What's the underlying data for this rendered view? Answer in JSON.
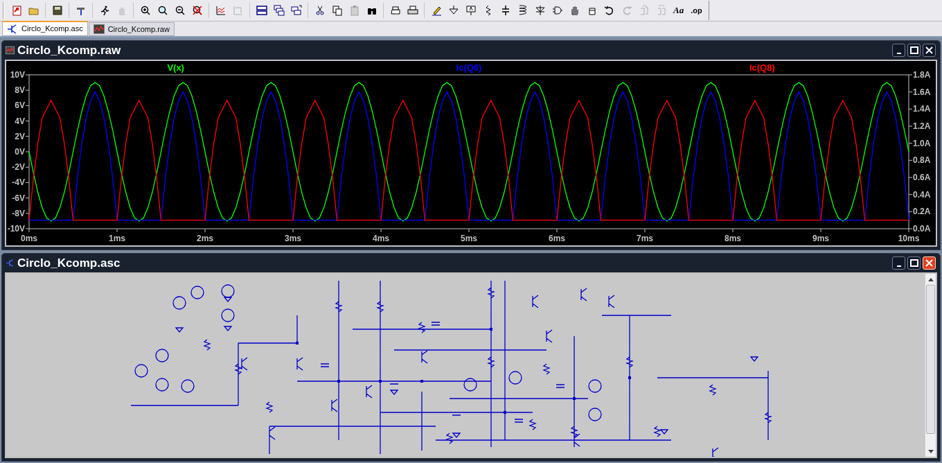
{
  "toolbar": {
    "text_buttons": [
      {
        "kind": "font",
        "label": "Aa"
      },
      {
        "kind": "op",
        "label": ".op"
      }
    ]
  },
  "tabs": [
    {
      "label": "Circlo_Kcomp.asc",
      "kind": "schematic",
      "selected": true
    },
    {
      "label": "Circlo_Kcomp.raw",
      "kind": "waveform",
      "selected": false
    }
  ],
  "windows": [
    {
      "kind": "waveform",
      "title": "Circlo_Kcomp.raw",
      "active": false,
      "chart_data": {
        "type": "line",
        "xlim": [
          0,
          10
        ],
        "ylim": [
          -10,
          10
        ],
        "y2lim": [
          0,
          1.8
        ],
        "xticks": [
          {
            "value": 0,
            "label": "0ms"
          },
          {
            "value": 1,
            "label": "1ms"
          },
          {
            "value": 2,
            "label": "2ms"
          },
          {
            "value": 3,
            "label": "3ms"
          },
          {
            "value": 4,
            "label": "4ms"
          },
          {
            "value": 5,
            "label": "5ms"
          },
          {
            "value": 6,
            "label": "6ms"
          },
          {
            "value": 7,
            "label": "7ms"
          },
          {
            "value": 8,
            "label": "8ms"
          },
          {
            "value": 9,
            "label": "9ms"
          },
          {
            "value": 10,
            "label": "10ms"
          }
        ],
        "yticks": [
          {
            "value": 10,
            "label": "10V"
          },
          {
            "value": 8,
            "label": "8V"
          },
          {
            "value": 6,
            "label": "6V"
          },
          {
            "value": 4,
            "label": "4V"
          },
          {
            "value": 2,
            "label": "2V"
          },
          {
            "value": 0,
            "label": "0V"
          },
          {
            "value": -2,
            "label": "-2V"
          },
          {
            "value": -4,
            "label": "-4V"
          },
          {
            "value": -6,
            "label": "-6V"
          },
          {
            "value": -8,
            "label": "-8V"
          },
          {
            "value": -10,
            "label": "-10V"
          }
        ],
        "y2ticks": [
          {
            "value": 1.8,
            "label": "1.8A"
          },
          {
            "value": 1.6,
            "label": "1.6A"
          },
          {
            "value": 1.4,
            "label": "1.4A"
          },
          {
            "value": 1.2,
            "label": "1.2A"
          },
          {
            "value": 1.0,
            "label": "1.0A"
          },
          {
            "value": 0.8,
            "label": "0.8A"
          },
          {
            "value": 0.6,
            "label": "0.6A"
          },
          {
            "value": 0.4,
            "label": "0.4A"
          },
          {
            "value": 0.2,
            "label": "0.2A"
          },
          {
            "value": 0.0,
            "label": "0.0A"
          }
        ],
        "x": [
          0,
          0.05,
          0.1,
          0.15,
          0.2,
          0.25,
          0.3,
          0.35,
          0.4,
          0.45,
          0.5,
          0.55,
          0.6,
          0.65,
          0.7,
          0.75,
          0.8,
          0.85,
          0.9,
          0.95,
          1,
          1.05,
          1.1,
          1.15,
          1.2,
          1.25,
          1.3,
          1.35,
          1.4,
          1.45,
          1.5,
          1.55,
          1.6,
          1.65,
          1.7,
          1.75,
          1.8,
          1.85,
          1.9,
          1.95,
          2,
          2.05,
          2.1,
          2.15,
          2.2,
          2.25,
          2.3,
          2.35,
          2.4,
          2.45,
          2.5,
          2.55,
          2.6,
          2.65,
          2.7,
          2.75,
          2.8,
          2.85,
          2.9,
          2.95,
          3,
          3.05,
          3.1,
          3.15,
          3.2,
          3.25,
          3.3,
          3.35,
          3.4,
          3.45,
          3.5,
          3.55,
          3.6,
          3.65,
          3.7,
          3.75,
          3.8,
          3.85,
          3.9,
          3.95,
          4,
          4.05,
          4.1,
          4.15,
          4.2,
          4.25,
          4.3,
          4.35,
          4.4,
          4.45,
          4.5,
          4.55,
          4.6,
          4.65,
          4.7,
          4.75,
          4.8,
          4.85,
          4.9,
          4.95,
          5,
          5.05,
          5.1,
          5.15,
          5.2,
          5.25,
          5.3,
          5.35,
          5.4,
          5.45,
          5.5,
          5.55,
          5.6,
          5.65,
          5.7,
          5.75,
          5.8,
          5.85,
          5.9,
          5.95,
          6,
          6.05,
          6.1,
          6.15,
          6.2,
          6.25,
          6.3,
          6.35,
          6.4,
          6.45,
          6.5,
          6.55,
          6.6,
          6.65,
          6.7,
          6.75,
          6.8,
          6.85,
          6.9,
          6.95,
          7,
          7.05,
          7.1,
          7.15,
          7.2,
          7.25,
          7.3,
          7.35,
          7.4,
          7.45,
          7.5,
          7.55,
          7.6,
          7.65,
          7.7,
          7.75,
          7.8,
          7.85,
          7.9,
          7.95,
          8,
          8.05,
          8.1,
          8.15,
          8.2,
          8.25,
          8.3,
          8.35,
          8.4,
          8.45,
          8.5,
          8.55,
          8.6,
          8.65,
          8.7,
          8.75,
          8.8,
          8.85,
          8.9,
          8.95,
          9,
          9.05,
          9.1,
          9.15,
          9.2,
          9.25,
          9.3,
          9.35,
          9.4,
          9.45,
          9.5,
          9.55,
          9.6,
          9.65,
          9.7,
          9.75,
          9.8,
          9.85,
          9.9,
          9.95,
          10
        ],
        "series": [
          {
            "name": "V(x)",
            "color": "#00ff00",
            "values": [
              0,
              -2.8,
              -5.3,
              -7.3,
              -8.6,
              -9,
              -8.6,
              -7.3,
              -5.3,
              -2.8,
              0,
              2.8,
              5.3,
              7.3,
              8.6,
              9,
              8.6,
              7.3,
              5.3,
              2.8,
              0,
              -2.8,
              -5.3,
              -7.3,
              -8.6,
              -9,
              -8.6,
              -7.3,
              -5.3,
              -2.8,
              0,
              2.8,
              5.3,
              7.3,
              8.6,
              9,
              8.6,
              7.3,
              5.3,
              2.8,
              0,
              -2.8,
              -5.3,
              -7.3,
              -8.6,
              -9,
              -8.6,
              -7.3,
              -5.3,
              -2.8,
              0,
              2.8,
              5.3,
              7.3,
              8.6,
              9,
              8.6,
              7.3,
              5.3,
              2.8,
              0,
              -2.8,
              -5.3,
              -7.3,
              -8.6,
              -9,
              -8.6,
              -7.3,
              -5.3,
              -2.8,
              0,
              2.8,
              5.3,
              7.3,
              8.6,
              9,
              8.6,
              7.3,
              5.3,
              2.8,
              0,
              -2.8,
              -5.3,
              -7.3,
              -8.6,
              -9,
              -8.6,
              -7.3,
              -5.3,
              -2.8,
              0,
              2.8,
              5.3,
              7.3,
              8.6,
              9,
              8.6,
              7.3,
              5.3,
              2.8,
              0,
              -2.8,
              -5.3,
              -7.3,
              -8.6,
              -9,
              -8.6,
              -7.3,
              -5.3,
              -2.8,
              0,
              2.8,
              5.3,
              7.3,
              8.6,
              9,
              8.6,
              7.3,
              5.3,
              2.8,
              0,
              -2.8,
              -5.3,
              -7.3,
              -8.6,
              -9,
              -8.6,
              -7.3,
              -5.3,
              -2.8,
              0,
              2.8,
              5.3,
              7.3,
              8.6,
              9,
              8.6,
              7.3,
              5.3,
              2.8,
              0,
              -2.8,
              -5.3,
              -7.3,
              -8.6,
              -9,
              -8.6,
              -7.3,
              -5.3,
              -2.8,
              0,
              2.8,
              5.3,
              7.3,
              8.6,
              9,
              8.6,
              7.3,
              5.3,
              2.8,
              0,
              -2.8,
              -5.3,
              -7.3,
              -8.6,
              -9,
              -8.6,
              -7.3,
              -5.3,
              -2.8,
              0,
              2.8,
              5.3,
              7.3,
              8.6,
              9,
              8.6,
              7.3,
              5.3,
              2.8,
              0,
              -2.8,
              -5.3,
              -7.3,
              -8.6,
              -9,
              -8.6,
              -7.3,
              -5.3,
              -2.8,
              0,
              2.8,
              5.3,
              7.3,
              8.6,
              9,
              8.6,
              7.3,
              5.3,
              2.8,
              0
            ]
          },
          {
            "name": "Ic(Q6)",
            "color": "#0000ff",
            "axis": "y2",
            "values": [
              0.1,
              0.1,
              0.1,
              0.1,
              0.1,
              0.1,
              0.1,
              0.1,
              0.1,
              0.1,
              0.1,
              0.6,
              1.0,
              1.3,
              1.5,
              1.6,
              1.5,
              1.3,
              1.0,
              0.6,
              0.1,
              0.1,
              0.1,
              0.1,
              0.1,
              0.1,
              0.1,
              0.1,
              0.1,
              0.1,
              0.1,
              0.6,
              1.0,
              1.3,
              1.5,
              1.6,
              1.5,
              1.3,
              1.0,
              0.6,
              0.1,
              0.1,
              0.1,
              0.1,
              0.1,
              0.1,
              0.1,
              0.1,
              0.1,
              0.1,
              0.1,
              0.6,
              1.0,
              1.3,
              1.5,
              1.6,
              1.5,
              1.3,
              1.0,
              0.6,
              0.1,
              0.1,
              0.1,
              0.1,
              0.1,
              0.1,
              0.1,
              0.1,
              0.1,
              0.1,
              0.1,
              0.6,
              1.0,
              1.3,
              1.5,
              1.6,
              1.5,
              1.3,
              1.0,
              0.6,
              0.1,
              0.1,
              0.1,
              0.1,
              0.1,
              0.1,
              0.1,
              0.1,
              0.1,
              0.1,
              0.1,
              0.6,
              1.0,
              1.3,
              1.5,
              1.6,
              1.5,
              1.3,
              1.0,
              0.6,
              0.1,
              0.1,
              0.1,
              0.1,
              0.1,
              0.1,
              0.1,
              0.1,
              0.1,
              0.1,
              0.1,
              0.6,
              1.0,
              1.3,
              1.5,
              1.6,
              1.5,
              1.3,
              1.0,
              0.6,
              0.1,
              0.1,
              0.1,
              0.1,
              0.1,
              0.1,
              0.1,
              0.1,
              0.1,
              0.1,
              0.1,
              0.6,
              1.0,
              1.3,
              1.5,
              1.6,
              1.5,
              1.3,
              1.0,
              0.6,
              0.1,
              0.1,
              0.1,
              0.1,
              0.1,
              0.1,
              0.1,
              0.1,
              0.1,
              0.1,
              0.1,
              0.6,
              1.0,
              1.3,
              1.5,
              1.6,
              1.5,
              1.3,
              1.0,
              0.6,
              0.1,
              0.1,
              0.1,
              0.1,
              0.1,
              0.1,
              0.1,
              0.1,
              0.1,
              0.1,
              0.1,
              0.6,
              1.0,
              1.3,
              1.5,
              1.6,
              1.5,
              1.3,
              1.0,
              0.6,
              0.1,
              0.1,
              0.1,
              0.1,
              0.1,
              0.1,
              0.1,
              0.1,
              0.1,
              0.1,
              0.1,
              0.6,
              1.0,
              1.3,
              1.5,
              1.6,
              1.5,
              1.3,
              1.0,
              0.6,
              0.1
            ]
          },
          {
            "name": "Ic(Q8)",
            "color": "#ff0000",
            "axis": "y2",
            "values": [
              0.1,
              0.6,
              1.0,
              1.3,
              1.4,
              1.5,
              1.4,
              1.3,
              1.0,
              0.6,
              0.1,
              0.1,
              0.1,
              0.1,
              0.1,
              0.1,
              0.1,
              0.1,
              0.1,
              0.1,
              0.1,
              0.6,
              1.0,
              1.3,
              1.4,
              1.5,
              1.4,
              1.3,
              1.0,
              0.6,
              0.1,
              0.1,
              0.1,
              0.1,
              0.1,
              0.1,
              0.1,
              0.1,
              0.1,
              0.1,
              0.1,
              0.6,
              1.0,
              1.3,
              1.4,
              1.5,
              1.4,
              1.3,
              1.0,
              0.6,
              0.1,
              0.1,
              0.1,
              0.1,
              0.1,
              0.1,
              0.1,
              0.1,
              0.1,
              0.1,
              0.1,
              0.6,
              1.0,
              1.3,
              1.4,
              1.5,
              1.4,
              1.3,
              1.0,
              0.6,
              0.1,
              0.1,
              0.1,
              0.1,
              0.1,
              0.1,
              0.1,
              0.1,
              0.1,
              0.1,
              0.1,
              0.6,
              1.0,
              1.3,
              1.4,
              1.5,
              1.4,
              1.3,
              1.0,
              0.6,
              0.1,
              0.1,
              0.1,
              0.1,
              0.1,
              0.1,
              0.1,
              0.1,
              0.1,
              0.1,
              0.1,
              0.6,
              1.0,
              1.3,
              1.4,
              1.5,
              1.4,
              1.3,
              1.0,
              0.6,
              0.1,
              0.1,
              0.1,
              0.1,
              0.1,
              0.1,
              0.1,
              0.1,
              0.1,
              0.1,
              0.1,
              0.6,
              1.0,
              1.3,
              1.4,
              1.5,
              1.4,
              1.3,
              1.0,
              0.6,
              0.1,
              0.1,
              0.1,
              0.1,
              0.1,
              0.1,
              0.1,
              0.1,
              0.1,
              0.1,
              0.1,
              0.6,
              1.0,
              1.3,
              1.4,
              1.5,
              1.4,
              1.3,
              1.0,
              0.6,
              0.1,
              0.1,
              0.1,
              0.1,
              0.1,
              0.1,
              0.1,
              0.1,
              0.1,
              0.1,
              0.1,
              0.6,
              1.0,
              1.3,
              1.4,
              1.5,
              1.4,
              1.3,
              1.0,
              0.6,
              0.1,
              0.1,
              0.1,
              0.1,
              0.1,
              0.1,
              0.1,
              0.1,
              0.1,
              0.1,
              0.1,
              0.6,
              1.0,
              1.3,
              1.4,
              1.5,
              1.4,
              1.3,
              1.0,
              0.6,
              0.1,
              0.1,
              0.1,
              0.1,
              0.1,
              0.1,
              0.1,
              0.1,
              0.1,
              0.1,
              0.1
            ]
          }
        ]
      }
    },
    {
      "kind": "schematic",
      "title": "Circlo_Kcomp.asc",
      "active": true
    }
  ]
}
